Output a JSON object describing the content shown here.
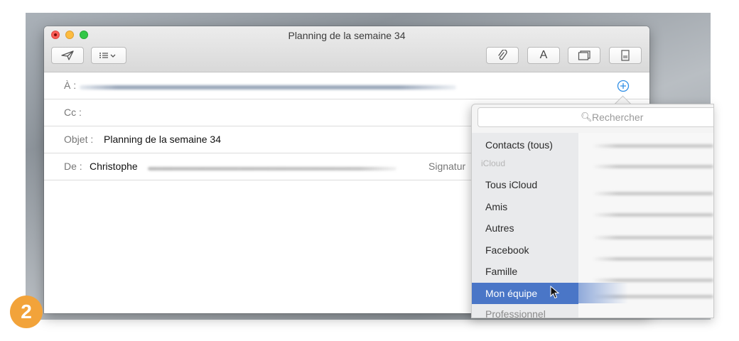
{
  "window": {
    "title": "Planning de la semaine 34"
  },
  "toolbar": {
    "send_icon": "paper-plane-icon",
    "header_fields_icon": "list-chevron-icon",
    "attach_icon": "paperclip-icon",
    "format_label": "A",
    "photo_browser_icon": "window-icon",
    "stationery_icon": "document-icon"
  },
  "fields": {
    "to_label": "À :",
    "cc_label": "Cc :",
    "subject_label": "Objet :",
    "subject_value": "Planning de la semaine 34",
    "from_label": "De :",
    "from_value": "Christophe",
    "signature_label": "Signatur",
    "add_contact_icon": "plus-circle-icon"
  },
  "contacts_popover": {
    "search_placeholder": "Rechercher",
    "groups": [
      {
        "label": "Contacts (tous)",
        "type": "item"
      },
      {
        "label": "iCloud",
        "type": "header"
      },
      {
        "label": "Tous iCloud",
        "type": "item"
      },
      {
        "label": "Amis",
        "type": "item"
      },
      {
        "label": "Autres",
        "type": "item"
      },
      {
        "label": "Facebook",
        "type": "item"
      },
      {
        "label": "Famille",
        "type": "item"
      },
      {
        "label": "Mon équipe",
        "type": "selected"
      },
      {
        "label": "Professionnel",
        "type": "item"
      }
    ]
  },
  "step_badge": "2",
  "colors": {
    "accent_selection": "#4a76c7",
    "badge": "#f2a33a",
    "link_blue": "#2f8ee6"
  }
}
